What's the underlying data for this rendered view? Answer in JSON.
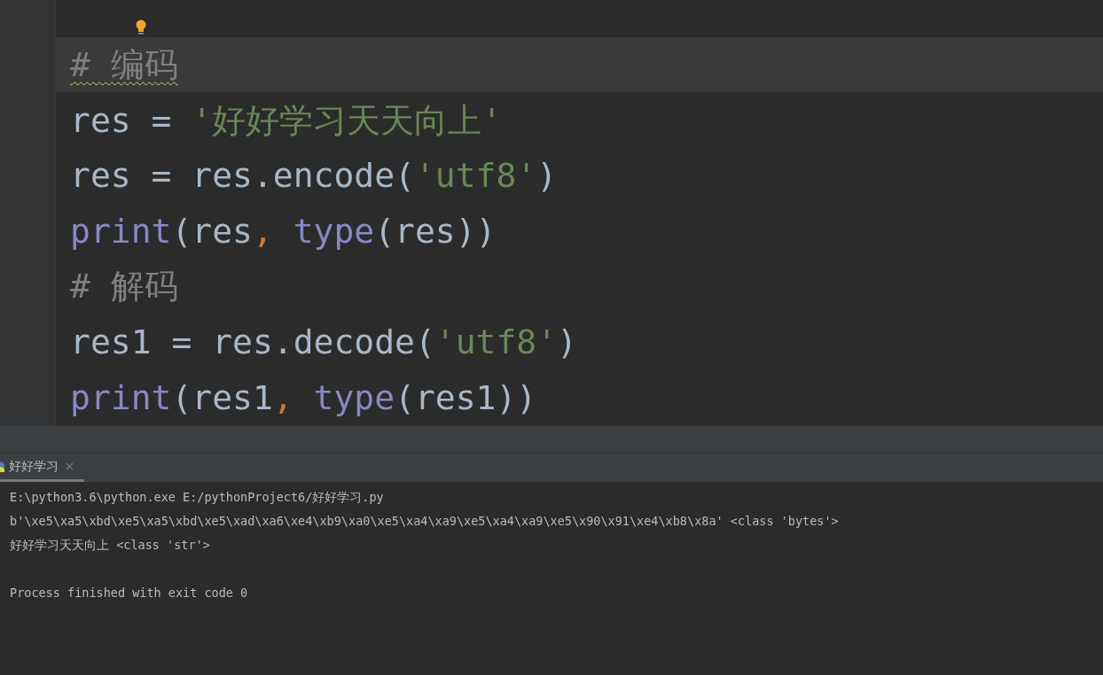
{
  "editor": {
    "lines": [
      {
        "current": true,
        "typo_warning": true,
        "tokens": [
          {
            "kind": "comment",
            "text": "# 编码"
          }
        ]
      },
      {
        "current": false,
        "typo_warning": false,
        "tokens": [
          {
            "kind": "ident",
            "text": "res = "
          },
          {
            "kind": "string",
            "text": "'好好学习天天向上'"
          }
        ]
      },
      {
        "current": false,
        "typo_warning": false,
        "tokens": [
          {
            "kind": "ident",
            "text": "res = res.encode("
          },
          {
            "kind": "string",
            "text": "'utf8'"
          },
          {
            "kind": "ident",
            "text": ")"
          }
        ]
      },
      {
        "current": false,
        "typo_warning": false,
        "tokens": [
          {
            "kind": "builtin",
            "text": "print"
          },
          {
            "kind": "ident",
            "text": "(res"
          },
          {
            "kind": "punct",
            "text": ", "
          },
          {
            "kind": "builtin",
            "text": "type"
          },
          {
            "kind": "ident",
            "text": "(res))"
          }
        ]
      },
      {
        "current": false,
        "typo_warning": false,
        "tokens": [
          {
            "kind": "comment",
            "text": "# 解码"
          }
        ]
      },
      {
        "current": false,
        "typo_warning": false,
        "tokens": [
          {
            "kind": "ident",
            "text": "res1 = res.decode("
          },
          {
            "kind": "string",
            "text": "'utf8'"
          },
          {
            "kind": "ident",
            "text": ")"
          }
        ]
      },
      {
        "current": false,
        "typo_warning": false,
        "tokens": [
          {
            "kind": "builtin",
            "text": "print"
          },
          {
            "kind": "ident",
            "text": "(res1"
          },
          {
            "kind": "punct",
            "text": ", "
          },
          {
            "kind": "builtin",
            "text": "type"
          },
          {
            "kind": "ident",
            "text": "(res1))"
          }
        ]
      }
    ]
  },
  "run_tabs": [
    {
      "label": "好好学习",
      "selected": true,
      "closable": true
    }
  ],
  "console": [
    {
      "text": "E:\\python3.6\\python.exe E:/pythonProject6/好好学习.py",
      "blank_before": false
    },
    {
      "text": "b'\\xe5\\xa5\\xbd\\xe5\\xa5\\xbd\\xe5\\xad\\xa6\\xe4\\xb9\\xa0\\xe5\\xa4\\xa9\\xe5\\xa4\\xa9\\xe5\\x90\\x91\\xe4\\xb8\\x8a' <class 'bytes'>",
      "blank_before": false
    },
    {
      "text": "好好学习天天向上 <class 'str'>",
      "blank_before": false
    },
    {
      "text": "Process finished with exit code 0",
      "blank_before": true
    }
  ]
}
